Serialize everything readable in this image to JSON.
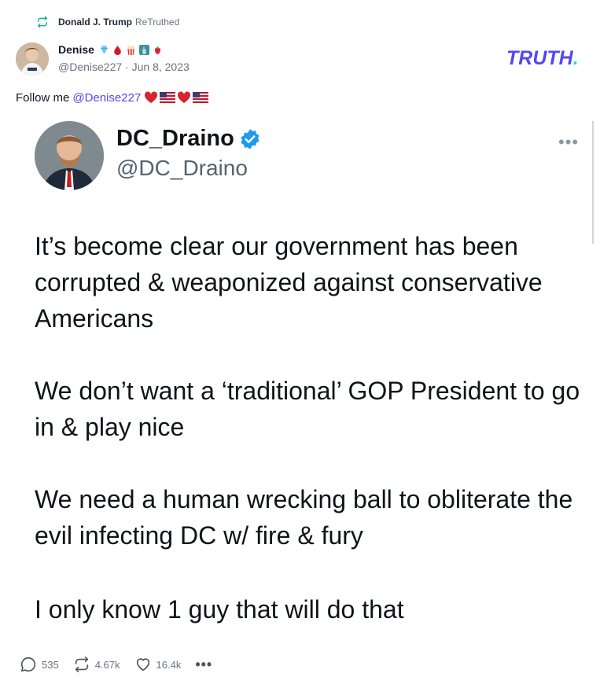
{
  "retruth": {
    "by": "Donald J. Trump",
    "action": "ReTruthed",
    "icon": "retruth-icon"
  },
  "author": {
    "name": "Denise",
    "handle": "@Denise227",
    "date": "Jun 8, 2023",
    "separator": "·",
    "emoji_icons": [
      "gem-icon",
      "drop-icon",
      "popcorn-icon",
      "statue-of-liberty-icon",
      "strawberry-icon"
    ]
  },
  "brand": {
    "logo": "TRUTH",
    "logo_dot": "."
  },
  "post": {
    "text": "Follow me",
    "mention": "@Denise227",
    "emoji_icons": [
      "heart-icon",
      "us-flag-icon",
      "heart-icon",
      "us-flag-icon"
    ]
  },
  "embedded_tweet": {
    "name": "DC_Draino",
    "handle": "@DC_Draino",
    "more": "•••",
    "paragraphs": [
      "It’s become clear our government has been corrupted & weaponized against conservative Americans",
      "We don’t want a ‘traditional’ GOP President to go in & play nice",
      "We need a human wrecking ball to obliterate the evil infecting DC w/ fire & fury",
      "I only know 1 guy that will do that"
    ]
  },
  "actions": {
    "replies": "535",
    "retruths": "4.67k",
    "likes": "16.4k",
    "more": "•••"
  },
  "colors": {
    "brand": "#5448ee",
    "brand_dot": "#17e8c4",
    "verified": "#1d9bf0",
    "muted": "#6b7280"
  }
}
